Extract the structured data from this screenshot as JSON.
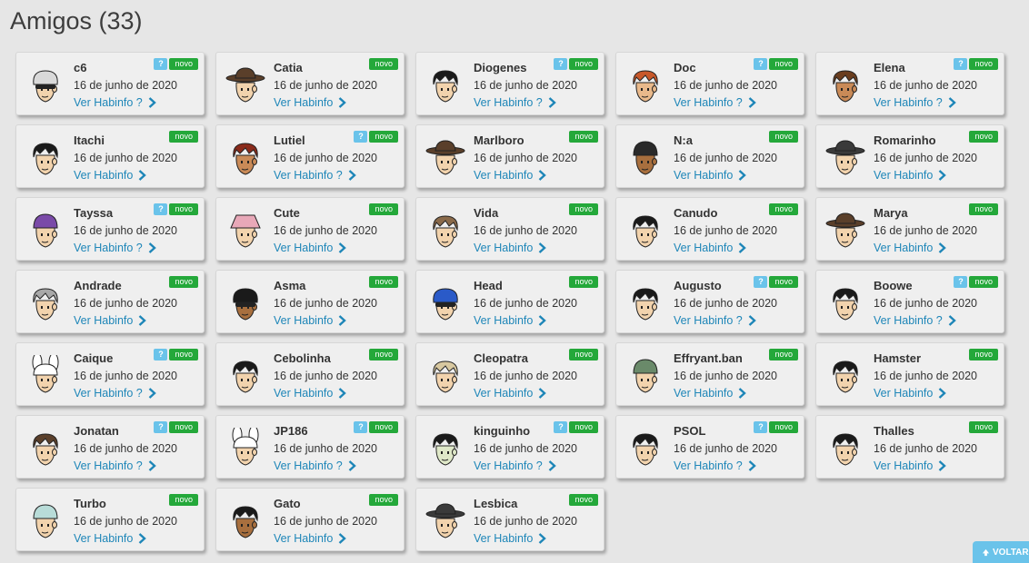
{
  "page": {
    "title": "Amigos (33)"
  },
  "labels": {
    "info_link": "Ver Habinfo",
    "new_badge": "novo",
    "q_badge": "?"
  },
  "colors": {
    "q_badge": "#6ac3ea",
    "new_badge": "#24a83a",
    "link": "#1e86b8",
    "card_bg": "#efefef",
    "page_bg": "#e6e6e6"
  },
  "icons": {
    "link_icon": "chevron-right-icon",
    "voltar_icon": "arrow-up-icon"
  },
  "friends": [
    {
      "name": "c6",
      "date": "16 de junho de 2020",
      "q": true,
      "hair": "#d9d9d9",
      "skin": "#f2d3ad",
      "hat": "shades"
    },
    {
      "name": "Catia",
      "date": "16 de junho de 2020",
      "q": false,
      "hair": "#5a3f2a",
      "skin": "#f2d3ad",
      "hat": "cowboy"
    },
    {
      "name": "Diogenes",
      "date": "16 de junho de 2020",
      "q": true,
      "hair": "#1a1a1a",
      "skin": "#f2d3ad",
      "hat": "none"
    },
    {
      "name": "Doc",
      "date": "16 de junho de 2020",
      "q": true,
      "hair": "#c8582a",
      "skin": "#e9b98b",
      "hat": "none"
    },
    {
      "name": "Elena",
      "date": "16 de junho de 2020",
      "q": true,
      "hair": "#6a3d1e",
      "skin": "#c98a57",
      "hat": "band"
    },
    {
      "name": "Itachi",
      "date": "16 de junho de 2020",
      "q": false,
      "hair": "#1a1a1a",
      "skin": "#f2d3ad",
      "hat": "none"
    },
    {
      "name": "Lutiel",
      "date": "16 de junho de 2020",
      "q": true,
      "hair": "#8a2a1a",
      "skin": "#c98a57",
      "hat": "none"
    },
    {
      "name": "Marlboro",
      "date": "16 de junho de 2020",
      "q": false,
      "hair": "#5a3f2a",
      "skin": "#f2d3ad",
      "hat": "cowboy"
    },
    {
      "name": "N:a",
      "date": "16 de junho de 2020",
      "q": false,
      "hair": "#2a2a2a",
      "skin": "#a86f3e",
      "hat": "beanie"
    },
    {
      "name": "Romarinho",
      "date": "16 de junho de 2020",
      "q": false,
      "hair": "#3a3a3a",
      "skin": "#f2d3ad",
      "hat": "cowboy"
    },
    {
      "name": "Tayssa",
      "date": "16 de junho de 2020",
      "q": true,
      "hair": "#7a4aa8",
      "skin": "#f2d3ad",
      "hat": "beanie"
    },
    {
      "name": "Cute",
      "date": "16 de junho de 2020",
      "q": false,
      "hair": "#e8a8b8",
      "skin": "#f2d3ad",
      "hat": "bucket"
    },
    {
      "name": "Vida",
      "date": "16 de junho de 2020",
      "q": false,
      "hair": "#8a6a4a",
      "skin": "#f2d3ad",
      "hat": "none"
    },
    {
      "name": "Canudo",
      "date": "16 de junho de 2020",
      "q": false,
      "hair": "#1a1a1a",
      "skin": "#f2d3ad",
      "hat": "none"
    },
    {
      "name": "Marya",
      "date": "16 de junho de 2020",
      "q": false,
      "hair": "#5a3f2a",
      "skin": "#f2d3ad",
      "hat": "cowboy"
    },
    {
      "name": "Andrade",
      "date": "16 de junho de 2020",
      "q": false,
      "hair": "#a8a8a8",
      "skin": "#f2d3ad",
      "hat": "none"
    },
    {
      "name": "Asma",
      "date": "16 de junho de 2020",
      "q": false,
      "hair": "#1a1a1a",
      "skin": "#a86f3e",
      "hat": "shades"
    },
    {
      "name": "Head",
      "date": "16 de junho de 2020",
      "q": false,
      "hair": "#2a5ac8",
      "skin": "#f2d3ad",
      "hat": "shades"
    },
    {
      "name": "Augusto",
      "date": "16 de junho de 2020",
      "q": true,
      "hair": "#1a1a1a",
      "skin": "#f2d3ad",
      "hat": "none"
    },
    {
      "name": "Boowe",
      "date": "16 de junho de 2020",
      "q": true,
      "hair": "#1a1a1a",
      "skin": "#f2d3ad",
      "hat": "none"
    },
    {
      "name": "Caique",
      "date": "16 de junho de 2020",
      "q": true,
      "hair": "#f5f5f5",
      "skin": "#f2d3ad",
      "hat": "bunny"
    },
    {
      "name": "Cebolinha",
      "date": "16 de junho de 2020",
      "q": false,
      "hair": "#1a1a1a",
      "skin": "#f2d3ad",
      "hat": "none"
    },
    {
      "name": "Cleopatra",
      "date": "16 de junho de 2020",
      "q": false,
      "hair": "#d8c8a0",
      "skin": "#f2d3ad",
      "hat": "none"
    },
    {
      "name": "Effryant.ban",
      "date": "16 de junho de 2020",
      "q": false,
      "hair": "#6a8a6a",
      "skin": "#f2d3ad",
      "hat": "beanie"
    },
    {
      "name": "Hamster",
      "date": "16 de junho de 2020",
      "q": false,
      "hair": "#1a1a1a",
      "skin": "#f2d3ad",
      "hat": "none"
    },
    {
      "name": "Jonatan",
      "date": "16 de junho de 2020",
      "q": true,
      "hair": "#5a3f2a",
      "skin": "#f2d3ad",
      "hat": "none"
    },
    {
      "name": "JP186",
      "date": "16 de junho de 2020",
      "q": true,
      "hair": "#f5f5f5",
      "skin": "#f2d3ad",
      "hat": "bunny"
    },
    {
      "name": "kinguinho",
      "date": "16 de junho de 2020",
      "q": true,
      "hair": "#1a1a1a",
      "skin": "#dfe8c8",
      "hat": "none"
    },
    {
      "name": "PSOL",
      "date": "16 de junho de 2020",
      "q": true,
      "hair": "#1a1a1a",
      "skin": "#f2d3ad",
      "hat": "none"
    },
    {
      "name": "Thalles",
      "date": "16 de junho de 2020",
      "q": false,
      "hair": "#1a1a1a",
      "skin": "#f2d3ad",
      "hat": "none"
    },
    {
      "name": "Turbo",
      "date": "16 de junho de 2020",
      "q": false,
      "hair": "#b8dcd8",
      "skin": "#f2d3ad",
      "hat": "beanie"
    },
    {
      "name": "Gato",
      "date": "16 de junho de 2020",
      "q": false,
      "hair": "#1a1a1a",
      "skin": "#a86f3e",
      "hat": "none"
    },
    {
      "name": "Lesbica",
      "date": "16 de junho de 2020",
      "q": false,
      "hair": "#3a3a3a",
      "skin": "#f2d3ad",
      "hat": "cowboy"
    }
  ],
  "voltar": {
    "label": "VOLTAR"
  }
}
